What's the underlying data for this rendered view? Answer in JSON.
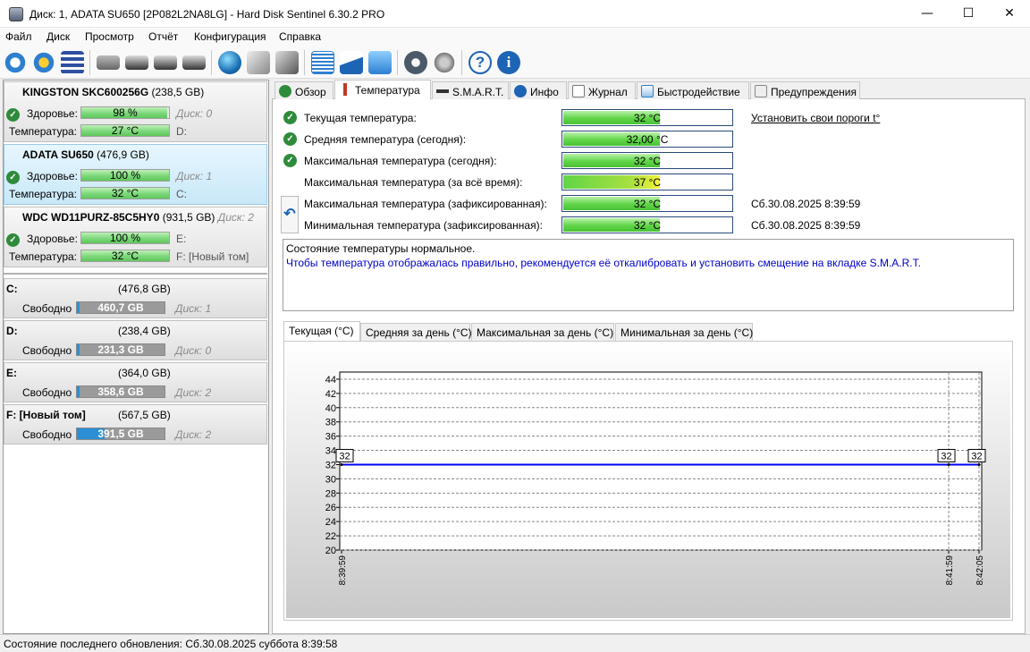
{
  "window": {
    "title": "Диск: 1, ADATA SU650 [2P082L2NA8LG]  -  Hard Disk Sentinel 6.30.2 PRO",
    "minimize": "—",
    "maximize": "☐",
    "close": "✕"
  },
  "menu": [
    "Файл",
    "Диск",
    "Просмотр",
    "Отчёт",
    "Конфигурация",
    "Справка"
  ],
  "disks": [
    {
      "name": "KINGSTON SKC600256G",
      "size": "(238,5 GB)",
      "health_label": "Здоровье:",
      "health": "98 %",
      "health_pct": 98,
      "disk_no": "Диск: 0",
      "temp_label": "Температура:",
      "temp": "27 °C",
      "drive": "D:",
      "drive_gray": false
    },
    {
      "name": "ADATA SU650",
      "size": "(476,9 GB)",
      "health_label": "Здоровье:",
      "health": "100 %",
      "health_pct": 100,
      "disk_no": "Диск: 1",
      "temp_label": "Температура:",
      "temp": "32 °C",
      "drive": "C:",
      "drive_gray": false
    },
    {
      "name": "WDC WD11PURZ-85C5HY0",
      "size": "(931,5 GB)",
      "disk_no": "Диск: 2",
      "health_label": "Здоровье:",
      "health": "100 %",
      "health_pct": 100,
      "temp_label": "Температура:",
      "temp": "32 °C",
      "drive": "E:",
      "drive2": "F: [Новый том]"
    }
  ],
  "volumes": [
    {
      "letter": "C:",
      "size": "(476,8 GB)",
      "free_label": "Свободно",
      "free": "460,7 GB",
      "disk": "Диск: 1",
      "bar_color": "#9a9a9a"
    },
    {
      "letter": "D:",
      "size": "(238,4 GB)",
      "free_label": "Свободно",
      "free": "231,3 GB",
      "disk": "Диск: 0",
      "bar_color": "#9a9a9a"
    },
    {
      "letter": "E:",
      "size": "(364,0 GB)",
      "free_label": "Свободно",
      "free": "358,6 GB",
      "disk": "Диск: 2",
      "bar_color": "#9a9a9a"
    },
    {
      "letter": "F: [Новый том]",
      "size": "(567,5 GB)",
      "free_label": "Свободно",
      "free": "391,5 GB",
      "disk": "Диск: 2",
      "bar_color": "#2b8fd6"
    }
  ],
  "tabs": [
    "Обзор",
    "Температура",
    "S.M.A.R.T.",
    "Инфо",
    "Журнал",
    "Быстродействие",
    "Предупреждения"
  ],
  "temps": [
    {
      "label": "Текущая температура:",
      "value": "32 °C",
      "check": true,
      "date": ""
    },
    {
      "label": "Средняя температура (сегодня):",
      "value": "32,00 °C",
      "check": true,
      "date": ""
    },
    {
      "label": "Максимальная температура (сегодня):",
      "value": "32 °C",
      "check": true,
      "date": ""
    },
    {
      "label": "Максимальная температура (за всё время):",
      "value": "37 °C",
      "check": false,
      "date": "",
      "yellow": true
    },
    {
      "label": "Максимальная температура (зафиксированная):",
      "value": "32 °C",
      "check": false,
      "date": "Сб.30.08.2025 8:39:59"
    },
    {
      "label": "Минимальная температура (зафиксированная):",
      "value": "32 °C",
      "check": false,
      "date": "Сб.30.08.2025 8:39:59"
    }
  ],
  "threshold_link": "Установить свои пороги t°",
  "info": {
    "line1": "Состояние температуры нормальное.",
    "line2": "Чтобы температура отображалась правильно, рекомендуется её откалибровать и установить смещение на вкладке S.M.A.R.T."
  },
  "graph_tabs": [
    "Текущая (°C)",
    "Средняя за день (°C)",
    "Максимальная за день (°C)",
    "Минимальная за день (°C)"
  ],
  "chart_data": {
    "type": "line",
    "x": [
      "8:39:59",
      "8:41:59",
      "8:42:05"
    ],
    "values": [
      32,
      32,
      32
    ],
    "point_labels": [
      "32",
      "32",
      "32"
    ],
    "yticks": [
      20,
      22,
      24,
      26,
      28,
      30,
      32,
      34,
      36,
      38,
      40,
      42,
      44
    ],
    "ylim": [
      20,
      45
    ],
    "grid": true,
    "line_color": "#0000ff"
  },
  "status": "Состояние последнего обновления: Сб.30.08.2025 суббота 8:39:58",
  "colors": {
    "accent": "#2e8b3a",
    "link": "#0000cc"
  }
}
